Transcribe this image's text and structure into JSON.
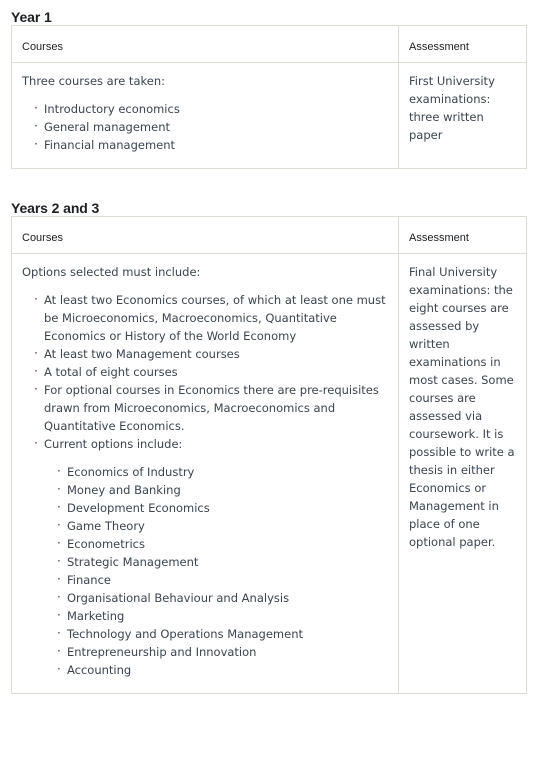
{
  "sections": [
    {
      "heading": "Year 1",
      "table": {
        "headers": {
          "courses": "Courses",
          "assessment": "Assessment"
        },
        "courses_intro": "Three courses are taken:",
        "courses_bullets": [
          "Introductory economics",
          "General management",
          "Financial management"
        ],
        "assessment_text": "First University examinations: three written paper"
      }
    },
    {
      "heading": "Years 2 and 3",
      "table": {
        "headers": {
          "courses": "Courses",
          "assessment": "Assessment"
        },
        "courses_intro": "Options selected must include:",
        "courses_bullets": [
          "At least two Economics courses, of which at least one must be Microeconomics, Macroeconomics, Quantitative Economics or History of the World Economy",
          "At least two Management courses",
          "A total of eight courses",
          "For optional courses in Economics there are pre-requisites drawn from Microeconomics, Macroeconomics and Quantitative Economics.",
          "Current options include:"
        ],
        "courses_sub_bullets": [
          "Economics of Industry",
          "Money and Banking",
          "Development Economics",
          "Game Theory",
          "Econometrics",
          "Strategic Management",
          "Finance",
          "Organisational Behaviour and Analysis",
          "Marketing",
          "Technology and Operations Management",
          "Entrepreneurship and Innovation",
          "Accounting"
        ],
        "assessment_text": "Final University examinations: the eight courses are assessed by written examinations in most cases. Some courses are assessed via coursework. It is possible to write a thesis in either Economics or Management in place of one optional paper."
      }
    }
  ],
  "colors": {
    "border": "#ddddd6",
    "heading_text": "#1c1f23",
    "body_text": "#3b4450",
    "background": "#ffffff"
  }
}
